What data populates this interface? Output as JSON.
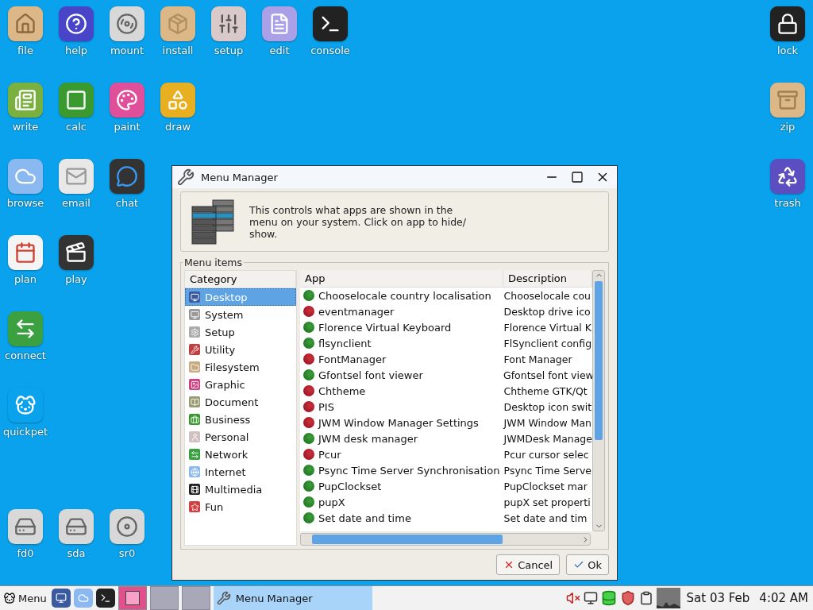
{
  "desktop": {
    "rows": [
      [
        "file",
        "help",
        "mount",
        "install",
        "setup",
        "edit",
        "console"
      ],
      [
        "write",
        "calc",
        "paint",
        "draw"
      ],
      [
        "browse",
        "email",
        "chat"
      ],
      [
        "plan",
        "play"
      ],
      [
        "connect"
      ],
      [
        "quickpet"
      ]
    ],
    "bottom_row": [
      "fd0",
      "sda",
      "sr0"
    ],
    "right_column": [
      "lock",
      "zip",
      "trash"
    ]
  },
  "window": {
    "title": "Menu Manager",
    "info": "This controls what apps are shown in the menu on your system. Click on app to hide/ show.",
    "group_label": "Menu items",
    "category_header": "Category",
    "categories": [
      {
        "label": "Desktop",
        "selected": true
      },
      {
        "label": "System",
        "selected": false
      },
      {
        "label": "Setup",
        "selected": false
      },
      {
        "label": "Utility",
        "selected": false
      },
      {
        "label": "Filesystem",
        "selected": false
      },
      {
        "label": "Graphic",
        "selected": false
      },
      {
        "label": "Document",
        "selected": false
      },
      {
        "label": "Business",
        "selected": false
      },
      {
        "label": "Personal",
        "selected": false
      },
      {
        "label": "Network",
        "selected": false
      },
      {
        "label": "Internet",
        "selected": false
      },
      {
        "label": "Multimedia",
        "selected": false
      },
      {
        "label": "Fun",
        "selected": false
      }
    ],
    "columns": [
      "App",
      "Description"
    ],
    "apps": [
      {
        "app": "Chooselocale country localisation",
        "description": "Chooselocale cou",
        "shown": true
      },
      {
        "app": "eventmanager",
        "description": "Desktop drive ico",
        "shown": false
      },
      {
        "app": "Florence Virtual Keyboard",
        "description": "Florence Virtual K",
        "shown": true
      },
      {
        "app": "flsynclient",
        "description": "FlSynclient config",
        "shown": true
      },
      {
        "app": "FontManager",
        "description": "Font Manager",
        "shown": false
      },
      {
        "app": "Gfontsel font viewer",
        "description": "Gfontsel font view",
        "shown": true
      },
      {
        "app": "Chtheme",
        "description": "Chtheme GTK/Qt",
        "shown": false
      },
      {
        "app": "PIS",
        "description": "Desktop icon swit",
        "shown": false
      },
      {
        "app": "JWM Window Manager Settings",
        "description": "JWM Window Man",
        "shown": false
      },
      {
        "app": "JWM desk manager",
        "description": "JWMDesk Manage",
        "shown": true
      },
      {
        "app": "Pcur",
        "description": "Pcur cursor selec",
        "shown": false
      },
      {
        "app": "Psync Time Server Synchronisation",
        "description": "Psync Time Serve",
        "shown": true
      },
      {
        "app": "PupClockset",
        "description": "PupClockset mar",
        "shown": true
      },
      {
        "app": "pupX",
        "description": "pupX set properti",
        "shown": true
      },
      {
        "app": "Set date and time",
        "description": "Set date and tim",
        "shown": true
      }
    ],
    "buttons": [
      "Cancel",
      "Ok"
    ]
  },
  "taskbar": {
    "menu_label": "Menu",
    "desks": [
      {
        "selected": true
      },
      {
        "selected": false
      },
      {
        "selected": false
      }
    ],
    "task": {
      "label": "Menu Manager",
      "selected": true
    },
    "date": "Sat 03 Feb",
    "time": "4:02 AM"
  }
}
